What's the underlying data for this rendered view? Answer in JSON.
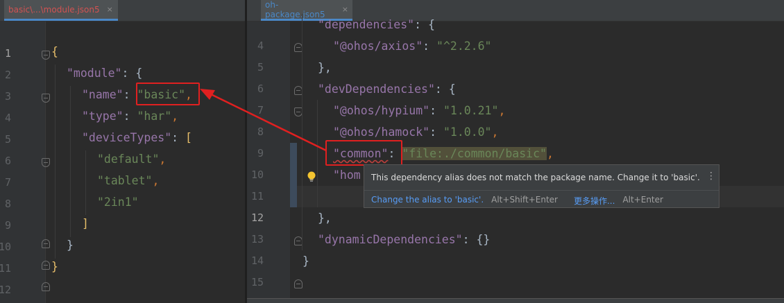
{
  "left_editor": {
    "tab_label": "basic\\...\\module.json5",
    "tab_close": "×",
    "line_numbers": [
      "1",
      "2",
      "3",
      "4",
      "5",
      "6",
      "7",
      "8",
      "9",
      "10",
      "11",
      "12"
    ],
    "lines": {
      "l1": "{",
      "l2_key": "\"module\"",
      "l2_rest": ": {",
      "l3_key": "\"name\"",
      "l3_colon": ": ",
      "l3_val": "\"basic\"",
      "l3_comma": ",",
      "l4_key": "\"type\"",
      "l4_colon": ": ",
      "l4_val": "\"har\"",
      "l4_comma": ",",
      "l5_key": "\"deviceTypes\"",
      "l5_colon": ": ",
      "l5_bracket": "[",
      "l6_val": "\"default\"",
      "l6_comma": ",",
      "l7_val": "\"tablet\"",
      "l7_comma": ",",
      "l8_val": "\"2in1\"",
      "l9": "]",
      "l10": "}",
      "l11": "}"
    }
  },
  "right_editor": {
    "tab_label": "oh-package.json5",
    "tab_close": "×",
    "line_numbers": [
      "4",
      "5",
      "6",
      "7",
      "8",
      "9",
      "10",
      "11",
      "12",
      "13",
      "14",
      "15"
    ],
    "lines": {
      "l4_key": "\"dependencies\"",
      "l4_rest": ": {",
      "l5_key": "\"@ohos/axios\"",
      "l5_colon": ": ",
      "l5_val": "\"^2.2.6\"",
      "l6": "},",
      "l7_key": "\"devDependencies\"",
      "l7_rest": ": {",
      "l8_key": "\"@ohos/hypium\"",
      "l8_colon": ": ",
      "l8_val": "\"1.0.21\"",
      "l8_comma": ",",
      "l9_key": "\"@ohos/hamock\"",
      "l9_colon": ": ",
      "l9_val": "\"1.0.0\"",
      "l9_comma": ",",
      "l10_key": "\"common\"",
      "l10_colon": ": ",
      "l10_val": "\"file:./common/basic\"",
      "l10_comma": ",",
      "l11_partial": "\"hom",
      "l13": "},",
      "l14_key": "\"dynamicDependencies\"",
      "l14_rest": ": {}",
      "l15": "}"
    }
  },
  "tooltip": {
    "message": "This dependency alias does not match the package name. Change it to 'basic'.",
    "more_icon": "⋮",
    "action_fix": "Change the alias to 'basic'.",
    "action_fix_shortcut": "Alt+Shift+Enter",
    "action_more": "更多操作...",
    "action_more_shortcut": "Alt+Enter"
  },
  "colors": {
    "annotation": "#e02020",
    "keyword": "#9876aa",
    "string": "#6a8759",
    "link": "#589df6"
  }
}
